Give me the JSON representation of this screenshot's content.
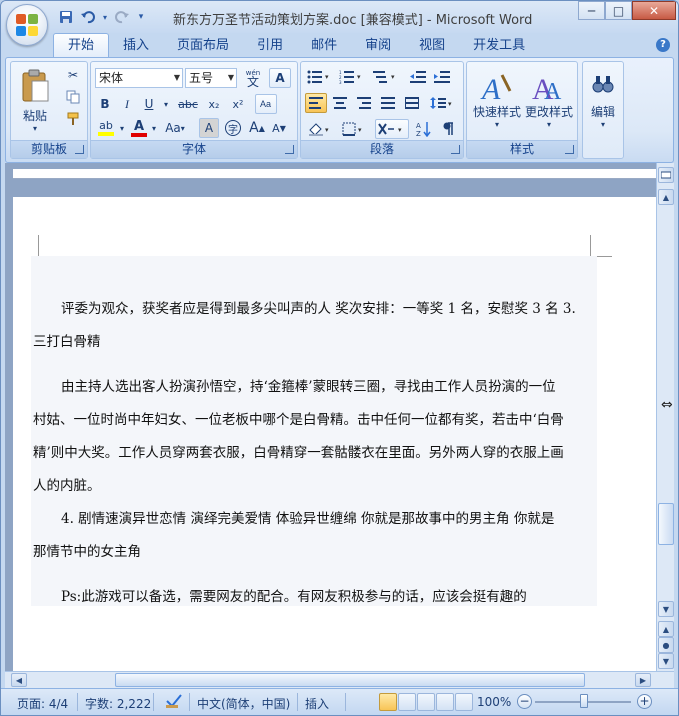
{
  "window": {
    "title": "新东方万圣节活动策划方案.doc [兼容模式] - Microsoft Word",
    "minimize": "─",
    "maximize": "□",
    "close": "✕"
  },
  "qat": {
    "save": "save-icon",
    "undo": "undo-icon",
    "redo": "redo-icon",
    "more": "▾"
  },
  "tabs": [
    "开始",
    "插入",
    "页面布局",
    "引用",
    "邮件",
    "审阅",
    "视图",
    "开发工具"
  ],
  "active_tab": "开始",
  "ribbon": {
    "clipboard": {
      "label": "剪贴板",
      "paste": "粘贴"
    },
    "font": {
      "label": "字体",
      "font_name": "宋体",
      "font_size": "五号",
      "wen": "wén",
      "wen_char": "文",
      "a_box": "A",
      "bold": "B",
      "italic": "I",
      "underline": "U",
      "strike": "abc",
      "sub": "x₂",
      "sup": "x²",
      "aa": "Aa",
      "grow": "A",
      "shrink": "A",
      "char_border": "A",
      "char_enclose": "字",
      "highlight": "ab",
      "font_color": "A"
    },
    "paragraph": {
      "label": "段落"
    },
    "styles": {
      "label": "样式",
      "quick": "快速样式",
      "change": "更改样式"
    },
    "editing": {
      "label": "编辑"
    }
  },
  "document": {
    "paragraphs": [
      [
        "评委为观众，获奖者应是得到最多尖叫声的人 奖次安排：一等奖 1 名，安慰奖 3 名 3.",
        "三打白骨精"
      ],
      [
        "由主持人选出客人扮演孙悟空，持‘金箍棒’蒙眼转三圈，寻找由工作人员扮演的一位",
        "村姑、一位时尚中年妇女、一位老板中哪个是白骨精。击中任何一位都有奖，若击中‘白骨",
        "精’则中大奖。工作人员穿两套衣服，白骨精穿一套骷髅衣在里面。另外两人穿的衣服上画",
        "人的内脏。"
      ],
      [
        "4. 剧情速演异世恋情 演绎完美爱情 体验异世缠绵 你就是那故事中的男主角 你就是",
        "那情节中的女主角"
      ],
      [
        "Ps:此游戏可以备选，需要网友的配合。有网友积极参与的话，应该会挺有趣的"
      ]
    ]
  },
  "statusbar": {
    "page": "页面: 4/4",
    "words": "字数: 2,222",
    "language": "中文(简体，中国)",
    "mode": "插入",
    "zoom": "100%",
    "zoom_out": "−",
    "zoom_in": "+"
  },
  "colors": {
    "accent": "#15428b",
    "highlight": "#ffff00",
    "font_color": "#e00000"
  }
}
